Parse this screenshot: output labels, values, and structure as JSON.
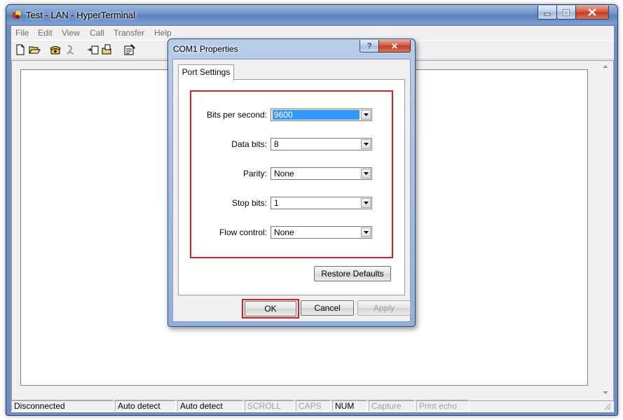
{
  "window": {
    "title": "Test - LAN - HyperTerminal"
  },
  "menu": [
    "File",
    "Edit",
    "View",
    "Call",
    "Transfer",
    "Help"
  ],
  "toolbar": [
    "new-icon",
    "open-icon",
    "phone-icon",
    "disconnect-icon",
    "send-icon",
    "receive-icon",
    "properties-icon"
  ],
  "statusbar": {
    "connection": "Disconnected",
    "detect1": "Auto detect",
    "detect2": "Auto detect",
    "scroll": "SCROLL",
    "caps": "CAPS",
    "num": "NUM",
    "capture": "Capture",
    "print_echo": "Print echo"
  },
  "dialog": {
    "title": "COM1 Properties",
    "help_glyph": "?",
    "close_glyph": "✕",
    "tab_label": "Port Settings",
    "fields": {
      "bits_per_second": {
        "label": "Bits per second:",
        "value": "9600"
      },
      "data_bits": {
        "label": "Data bits:",
        "value": "8"
      },
      "parity": {
        "label": "Parity:",
        "value": "None"
      },
      "stop_bits": {
        "label": "Stop bits:",
        "value": "1"
      },
      "flow_control": {
        "label": "Flow control:",
        "value": "None"
      }
    },
    "restore_defaults": "Restore Defaults",
    "ok": "OK",
    "cancel": "Cancel",
    "apply": "Apply"
  },
  "colors": {
    "highlight_red": "#d22027",
    "selection_blue": "#3399ff"
  }
}
